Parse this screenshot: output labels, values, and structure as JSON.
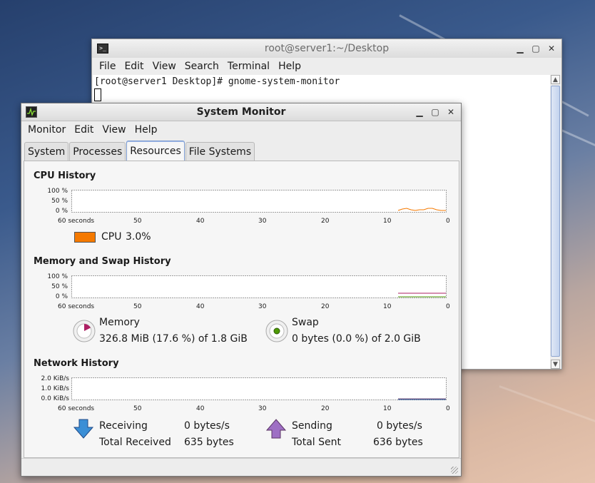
{
  "terminal": {
    "title": "root@server1:~/Desktop",
    "menu": [
      "File",
      "Edit",
      "View",
      "Search",
      "Terminal",
      "Help"
    ],
    "prompt_line": "[root@server1 Desktop]# gnome-system-monitor"
  },
  "sysmon": {
    "title": "System Monitor",
    "menu": [
      "Monitor",
      "Edit",
      "View",
      "Help"
    ],
    "tabs": [
      "System",
      "Processes",
      "Resources",
      "File Systems"
    ],
    "active_tab": "Resources",
    "cpu": {
      "title": "CPU History",
      "y_ticks": [
        "100 %",
        "50 %",
        "0 %"
      ],
      "x_ticks": [
        "60 seconds",
        "50",
        "40",
        "30",
        "20",
        "10",
        "0"
      ],
      "legend_label": "CPU",
      "legend_value": "3.0%",
      "color": "#f57900"
    },
    "memory": {
      "title": "Memory and Swap History",
      "y_ticks": [
        "100 %",
        "50 %",
        "0 %"
      ],
      "x_ticks": [
        "60 seconds",
        "50",
        "40",
        "30",
        "20",
        "10",
        "0"
      ],
      "mem_label": "Memory",
      "mem_value": "326.8 MiB (17.6 %) of 1.8 GiB",
      "swap_label": "Swap",
      "swap_value": "0 bytes (0.0 %) of 2.0 GiB",
      "mem_color": "#ad1f63",
      "swap_color": "#4e9a06",
      "mem_percent": 17.6,
      "swap_percent": 0.0
    },
    "network": {
      "title": "Network History",
      "y_ticks": [
        "2.0 KiB/s",
        "1.0 KiB/s",
        "0.0 KiB/s"
      ],
      "x_ticks": [
        "60 seconds",
        "50",
        "40",
        "30",
        "20",
        "10",
        "0"
      ],
      "receiving_label": "Receiving",
      "receiving_value": "0 bytes/s",
      "total_received_label": "Total Received",
      "total_received_value": "635 bytes",
      "sending_label": "Sending",
      "sending_value": "0 bytes/s",
      "total_sent_label": "Total Sent",
      "total_sent_value": "636 bytes",
      "recv_color": "#3465a4",
      "send_color": "#75507b"
    }
  }
}
